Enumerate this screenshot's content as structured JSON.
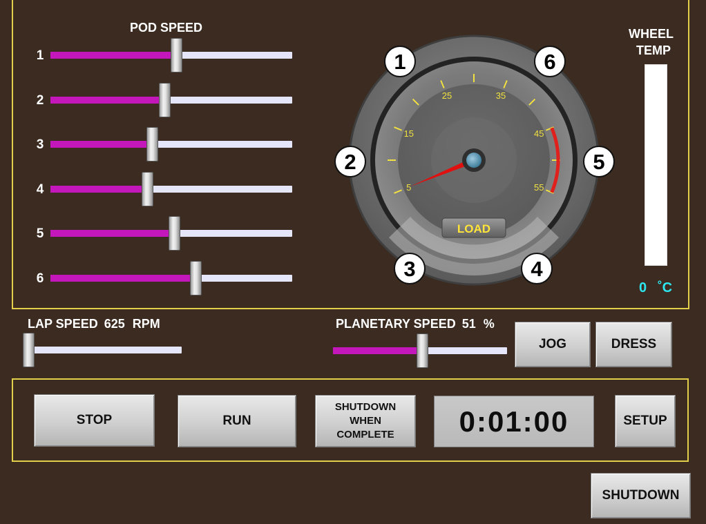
{
  "colors": {
    "accent": "#c317bc",
    "panel_border": "#e2d04a",
    "temp_readout": "#2ee6ef",
    "redline": "#e0201c"
  },
  "pod_speed": {
    "title": "POD SPEED",
    "sliders": [
      {
        "label": "1",
        "value": 0.52
      },
      {
        "label": "2",
        "value": 0.47
      },
      {
        "label": "3",
        "value": 0.42
      },
      {
        "label": "4",
        "value": 0.4
      },
      {
        "label": "5",
        "value": 0.51
      },
      {
        "label": "6",
        "value": 0.6
      }
    ]
  },
  "gauge": {
    "tick_labels": [
      "5",
      "15",
      "25",
      "35",
      "45",
      "55"
    ],
    "center_label": "LOAD",
    "needle_value": 5,
    "pod_markers": [
      "1",
      "6",
      "2",
      "5",
      "3",
      "4"
    ]
  },
  "wheel_temp": {
    "title_line1": "WHEEL",
    "title_line2": "TEMP",
    "value": "0",
    "unit": "˚C",
    "level": 0
  },
  "lap_speed": {
    "label": "LAP SPEED",
    "value": "625",
    "unit": "RPM",
    "level": 0.0
  },
  "planetary_speed": {
    "label": "PLANETARY SPEED",
    "value": "51",
    "unit": "%",
    "level": 0.51
  },
  "buttons": {
    "jog": "JOG",
    "dress": "DRESS",
    "stop": "STOP",
    "run": "RUN",
    "shutdown_when_1": "SHUTDOWN",
    "shutdown_when_2": "WHEN",
    "shutdown_when_3": "COMPLETE",
    "setup": "SETUP",
    "shutdown": "SHUTDOWN"
  },
  "timer": "0:01:00"
}
